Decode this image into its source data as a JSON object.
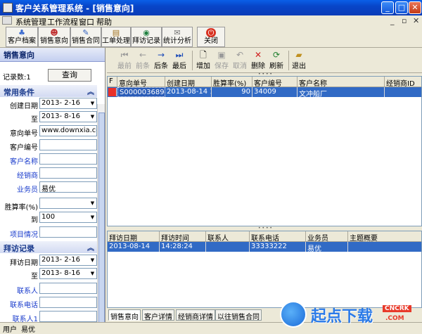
{
  "window": {
    "title": "客户关系管理系统 - [销售意向]"
  },
  "menu": [
    "系统管理",
    "工作流程",
    "窗口",
    "帮助"
  ],
  "toolbar": [
    {
      "label": "客户档案",
      "icon": "customer-file-icon"
    },
    {
      "label": "销售意向",
      "icon": "sales-intent-icon"
    },
    {
      "label": "销售合同",
      "icon": "contract-icon"
    },
    {
      "label": "工单处理",
      "icon": "workorder-icon"
    },
    {
      "label": "拜访记录",
      "icon": "visit-icon"
    },
    {
      "label": "统计分析",
      "icon": "statistics-icon"
    },
    {
      "label": "关闭",
      "icon": "close-icon"
    }
  ],
  "left": {
    "panel_title": "销售意向",
    "record_count": "记录数:1",
    "query_label": "查询",
    "section1": "常用条件",
    "create_date_label": "创建日期",
    "create_date_from": "2013- 2-16",
    "to_label": "至",
    "create_date_to": "2013- 8-16",
    "intent_no_label": "意向单号",
    "intent_no_value": "www.downxia.com",
    "cust_no_label": "客户编号",
    "cust_name_label": "客户名称",
    "dealer_label": "经销商",
    "salesman_label": "业务员",
    "salesman_value": "易优",
    "prob_label": "胜算率(%)",
    "prob_to_label": "到",
    "prob_to_value": "100",
    "item_label": "项目情况",
    "section2": "拜访记录",
    "visit_date_label": "拜访日期",
    "visit_date_from": "2013- 2-16",
    "visit_date_to": "2013- 8-16",
    "contact_label": "联系人",
    "phone_label": "联系电话",
    "contact1_label": "联系人1"
  },
  "nav": [
    {
      "label": "最前",
      "icon": "first-icon",
      "disabled": true
    },
    {
      "label": "前条",
      "icon": "prev-icon",
      "disabled": true
    },
    {
      "label": "后条",
      "icon": "next-icon",
      "disabled": false
    },
    {
      "label": "最后",
      "icon": "last-icon",
      "disabled": false
    },
    {
      "label": "增加",
      "icon": "add-icon",
      "disabled": false
    },
    {
      "label": "保存",
      "icon": "save-icon",
      "disabled": true
    },
    {
      "label": "取消",
      "icon": "undo-icon",
      "disabled": true
    },
    {
      "label": "删除",
      "icon": "delete-icon",
      "disabled": false
    },
    {
      "label": "刷新",
      "icon": "refresh-icon",
      "disabled": false
    },
    {
      "label": "退出",
      "icon": "exit-icon",
      "disabled": false
    }
  ],
  "grid1": {
    "headers": [
      "F",
      "意向单号",
      "创建日期",
      "胜算率(%)",
      "客户编号",
      "客户名称",
      "经销商ID"
    ],
    "rows": [
      [
        "",
        "S000003689",
        "2013-08-14 1",
        "90",
        "34009",
        "文冲船厂",
        ""
      ]
    ]
  },
  "grid2": {
    "headers": [
      "拜访日期",
      "拜访时间",
      "联系人",
      "联系电话",
      "业务员",
      "主题概要"
    ],
    "rows": [
      [
        "2013-08-14",
        "14:28:24",
        "",
        "33333222",
        "易优",
        ""
      ]
    ]
  },
  "tabs": [
    "销售意向",
    "客户详情",
    "经销商详情",
    "以往销售合同"
  ],
  "status": {
    "user_label": "用户",
    "user_value": "易优"
  },
  "watermark": {
    "text": "起点下载",
    "badge": "CNCRK",
    "sub": ".COM"
  },
  "colors": {
    "selection": "#316ac5",
    "title_blue": "#0a5fe8",
    "marker_red": "#e8312a"
  }
}
